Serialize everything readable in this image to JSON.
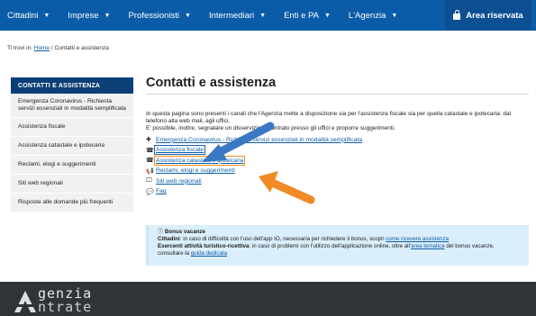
{
  "nav": {
    "items": [
      {
        "label": "Cittadini",
        "has_menu": true
      },
      {
        "label": "Imprese",
        "has_menu": true
      },
      {
        "label": "Professionisti",
        "has_menu": true
      },
      {
        "label": "Intermediari",
        "has_menu": true
      },
      {
        "label": "Enti e PA",
        "has_menu": true
      },
      {
        "label": "L'Agenzia",
        "has_menu": true
      }
    ],
    "reserved_area": "Area riservata",
    "chevron": "▼"
  },
  "breadcrumb": {
    "prefix": "Ti trovi in:",
    "home": "Home",
    "sep": "/",
    "current": "Contatti e assistenza"
  },
  "sidebar": {
    "title": "CONTATTI E ASSISTENZA",
    "items": [
      "Emergenza Coronavirus - Richiesta servizi essenziali in modalità semplificata",
      "Assistenza fiscale",
      "Assistenza catastale e ipotecaria",
      "Reclami, elogi e suggerimenti",
      "Siti web regionali",
      "Risposte alle domande più frequenti"
    ]
  },
  "main": {
    "title": "Contatti e assistenza",
    "intro_1": "In questa pagina sono presenti i canali che l'Agenzia mette a disposizione sia per l'assistenza fiscale sia per quella catastale e ipotecaria: dal telefono alla web mail, agli uffici.",
    "intro_2": "E' possibile, inoltre, segnalare un disservizio riscontrato presso gli uffici e proporre suggerimenti.",
    "links": [
      {
        "icon": "✚",
        "label": "Emergenza Coronavirus - Richiesta servizi essenziali in modalità semplificata"
      },
      {
        "icon": "☎",
        "label": "Assistenza fiscale"
      },
      {
        "icon": "☎",
        "label": "Assistenza catastale e ipotecaria"
      },
      {
        "icon": "📢",
        "label": "Reclami, elogi e suggerimenti"
      },
      {
        "icon": "🖵",
        "label": "Siti web regionali"
      },
      {
        "icon": "💬",
        "label": "Faq"
      }
    ]
  },
  "notice": {
    "title": "Bonus vacanze",
    "line1_bold": "Cittadini",
    "line1_text": ": in caso di difficoltà con l'uso dell'app IO, necessaria per richiedere il bonus, scopri ",
    "line1_link": "come ricevere assistenza",
    "line2_bold": "Esercenti attività turistico-ricettiva",
    "line2_text": ": in caso di problemi con l'utilizzo dell'applicazione online, oltre all'",
    "line2_link": "area tematica",
    "line2_text_b": " del bonus vacanze,",
    "line3_text": "consultare la ",
    "line3_link": "guida dedicata"
  },
  "footer": {
    "logo_line1": "genzia",
    "logo_line2": "ntrate"
  },
  "colors": {
    "nav": "#0b5ca8",
    "sidebar_head": "#0b3f76",
    "highlight_blue": "#1b5fae",
    "highlight_orange": "#f08a24",
    "footer": "#2f3438"
  }
}
